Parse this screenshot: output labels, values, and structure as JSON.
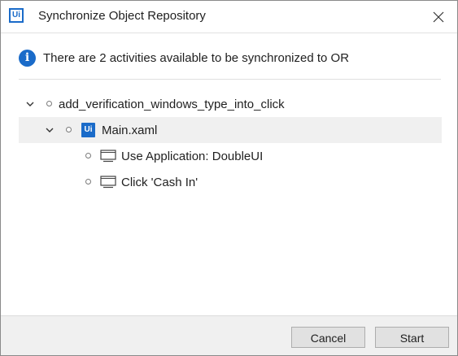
{
  "window": {
    "title": "Synchronize Object Repository",
    "logo_text": "Ui",
    "close_icon": "close-icon"
  },
  "info": {
    "icon": "info-icon",
    "icon_glyph": "i",
    "message": "There are 2 activities available to be synchronized to OR"
  },
  "tree": {
    "project": {
      "label": "add_verification_windows_type_into_click",
      "expanded": true,
      "file": {
        "label": "Main.xaml",
        "icon_text": "Ui",
        "expanded": true,
        "selected": true,
        "activities": [
          {
            "label": "Use Application: DoubleUI",
            "icon": "screen-icon"
          },
          {
            "label": "Click 'Cash In'",
            "icon": "screen-icon"
          }
        ]
      }
    }
  },
  "footer": {
    "cancel_label": "Cancel",
    "start_label": "Start"
  },
  "colors": {
    "accent": "#1a6bc9",
    "selection": "#f0f0f0",
    "footer_bg": "#f0f0f0",
    "button_bg": "#e1e1e1"
  }
}
